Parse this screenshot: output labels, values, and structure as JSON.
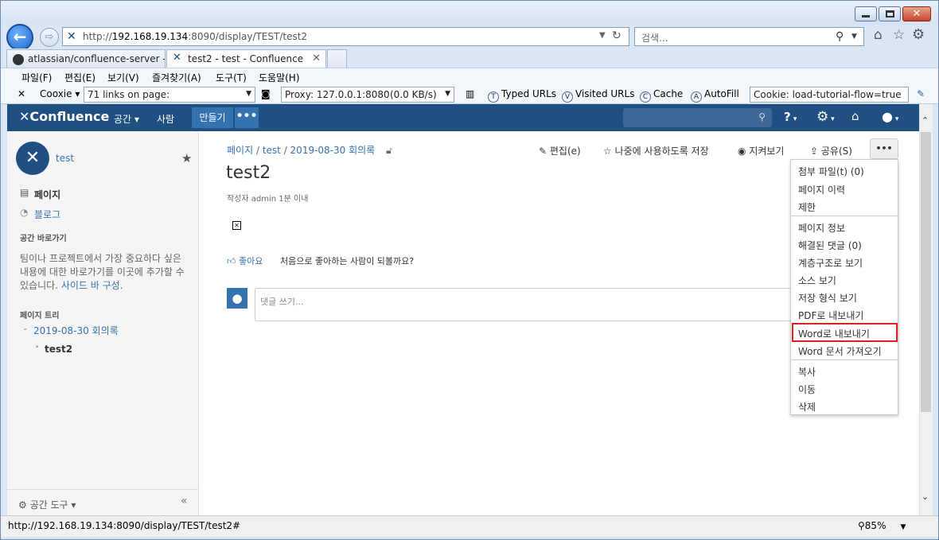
{
  "browser": {
    "url_prefix": "http://",
    "url_host": "192.168.19.134",
    "url_rest": ":8090/display/TEST/test2",
    "search_placeholder": "검색...",
    "tabs": [
      {
        "label": "atlassian/confluence-server - ..."
      },
      {
        "label": "test2 - test - Confluence"
      }
    ],
    "menu": [
      "파일(F)",
      "편집(E)",
      "보기(V)",
      "즐겨찾기(A)",
      "도구(T)",
      "도움말(H)"
    ],
    "toolbar": {
      "cooxie": "Cooxie",
      "links": "71 links on page:",
      "proxy": "Proxy: 127.0.0.1:8080",
      "speed": "(0.0 KB/s)",
      "typed_urls": "Typed URLs",
      "visited_urls": "Visited URLs",
      "cache": "Cache",
      "autofill": "AutoFill",
      "cookie": "Cookie: load-tutorial-flow=true"
    },
    "status_url": "http://192.168.19.134:8090/display/TEST/test2#",
    "zoom": "85%"
  },
  "confluence": {
    "logo": "Confluence",
    "nav": {
      "spaces": "공간",
      "people": "사람",
      "create": "만들기",
      "more": "•••"
    }
  },
  "sidebar": {
    "space_name": "test",
    "pages": "페이지",
    "blog": "블로그",
    "shortcuts_heading": "공간 바로가기",
    "shortcuts_text": "팀이나 프로젝트에서 가장 중요하다 싶은 내용에 대한 바로가기를 이곳에 추가할 수 있습니다.",
    "shortcuts_link": "사이드 바 구성",
    "tree_heading": "페이지 트리",
    "tree_parent": "2019-08-30 회의록",
    "tree_child": "test2",
    "space_tools": "공간 도구"
  },
  "page": {
    "breadcrumb": [
      "페이지",
      "test",
      "2019-08-30 회의록"
    ],
    "actions": {
      "edit": "편집(e)",
      "save_later": "나중에 사용하도록 저장",
      "watch": "지켜보기",
      "share": "공유(S)",
      "more": "•••"
    },
    "title": "test2",
    "byline": "작성자 admin 1분 이내",
    "like": "좋아요",
    "like_prompt": "처음으로 좋아하는 사람이 되볼까요?",
    "comment_placeholder": "댓글 쓰기..."
  },
  "dropdown": {
    "items": [
      "첨부 파일(t) (0)",
      "페이지 이력",
      "제한",
      "페이지 정보",
      "해결된 댓글 (0)",
      "계층구조로 보기",
      "소스 보기",
      "저장 형식 보기",
      "PDF로 내보내기",
      "Word로 내보내기",
      "Word 문서 가져오기",
      "복사",
      "이동",
      "삭제"
    ]
  },
  "colors": {
    "header": "#205081",
    "link": "#3572b0",
    "highlight": "#e02020"
  }
}
